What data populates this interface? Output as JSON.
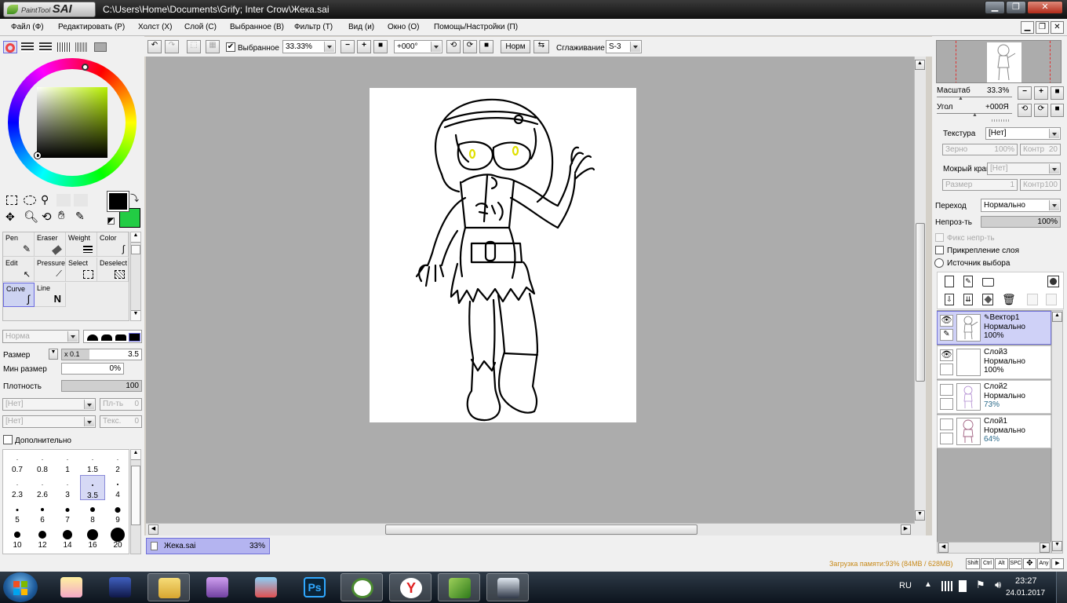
{
  "window": {
    "title": "C:\\Users\\Home\\Documents\\Grify; Inter Crow\\Жека.sai",
    "logo_top": "PaintTool",
    "logo_main": "SAI"
  },
  "menu": [
    "Файл (Ф)",
    "Редактировать (Р)",
    "Холст (Х)",
    "Слой (С)",
    "Выбранное (В)",
    "Фильтр (Т)",
    "Вид (и)",
    "Окно (О)",
    "Помощь/Настройки (П)"
  ],
  "toolbar": {
    "selection_label": "Выбранное",
    "zoom": "33.33%",
    "angle": "+000°",
    "mode_btn": "Норм",
    "smoothing_label": "Сглаживание",
    "smoothing_value": "S-3"
  },
  "tools": [
    {
      "name": "Pen",
      "icon": "pen-icon"
    },
    {
      "name": "Eraser",
      "icon": "eraser-icon"
    },
    {
      "name": "Weight",
      "icon": "weight-icon"
    },
    {
      "name": "Color",
      "icon": "color-icon"
    },
    {
      "name": "Edit",
      "icon": "edit-icon"
    },
    {
      "name": "Pressure",
      "icon": "pressure-icon"
    },
    {
      "name": "Select",
      "icon": "select-icon"
    },
    {
      "name": "Deselect",
      "icon": "deselect-icon"
    },
    {
      "name": "Curve",
      "icon": "curve-icon"
    },
    {
      "name": "Line",
      "icon": "line-icon"
    }
  ],
  "brush": {
    "mode": "Норма",
    "size_label": "Размер",
    "size_mult": "x 0.1",
    "size_value": "3.5",
    "min_size_label": "Мин размер",
    "min_size_value": "0%",
    "density_label": "Плотность",
    "density_value": "100",
    "texture1": "[Нет]",
    "texture1_label": "Пл-ть",
    "texture1_value": "0",
    "texture2": "[Нет]",
    "texture2_label": "Текс.",
    "texture2_value": "0",
    "advanced_label": "Дополнительно"
  },
  "brush_sizes": [
    {
      "label": "0.7",
      "dot": 1
    },
    {
      "label": "0.8",
      "dot": 1
    },
    {
      "label": "1",
      "dot": 1
    },
    {
      "label": "1.5",
      "dot": 1
    },
    {
      "label": "2",
      "dot": 1
    },
    {
      "label": "2.3",
      "dot": 1
    },
    {
      "label": "2.6",
      "dot": 1
    },
    {
      "label": "3",
      "dot": 1
    },
    {
      "label": "3.5",
      "dot": 2
    },
    {
      "label": "4",
      "dot": 2
    },
    {
      "label": "5",
      "dot": 3
    },
    {
      "label": "6",
      "dot": 4
    },
    {
      "label": "7",
      "dot": 5
    },
    {
      "label": "8",
      "dot": 6
    },
    {
      "label": "9",
      "dot": 7
    },
    {
      "label": "10",
      "dot": 8
    },
    {
      "label": "12",
      "dot": 10
    },
    {
      "label": "14",
      "dot": 12
    },
    {
      "label": "16",
      "dot": 14
    },
    {
      "label": "20",
      "dot": 18
    }
  ],
  "navigator": {
    "zoom_label": "Масштаб",
    "zoom_value": "33.3%",
    "angle_label": "Угол",
    "angle_value": "+000Я"
  },
  "layer_props": {
    "texture_label": "Текстура",
    "texture_value": "[Нет]",
    "grain_label": "Зерно",
    "grain_value": "100%",
    "contrast_label": "Контр",
    "contrast_value": "20",
    "wet_label": "Мокрый край",
    "wet_value": "[Нет]",
    "wsize_label": "Размер",
    "wsize_value": "1",
    "wcontrast_label": "Контр",
    "wcontrast_value": "100",
    "blend_label": "Переход",
    "blend_value": "Нормально",
    "opacity_label": "Непроз-ть",
    "opacity_value": "100%",
    "fix_label": "Фикс непр-ть",
    "clip_label": "Прикрепление слоя",
    "source_label": "Источник выбора"
  },
  "layers": [
    {
      "name": "Вектор1",
      "mode": "Нормально",
      "opacity": "100%"
    },
    {
      "name": "Слой3",
      "mode": "Нормально",
      "opacity": "100%"
    },
    {
      "name": "Слой2",
      "mode": "Нормально",
      "opacity": "73%"
    },
    {
      "name": "Слой1",
      "mode": "Нормально",
      "opacity": "64%"
    }
  ],
  "doc_tab": {
    "name": "Жека.sai",
    "zoom": "33%"
  },
  "status": {
    "memory": "Загрузка памяти:93% (84MB / 628MB)",
    "keys": [
      "Shift",
      "Ctrl",
      "Alt",
      "SPC",
      "",
      "Any"
    ]
  },
  "taskbar": {
    "lang": "RU",
    "time": "23:27",
    "date": "24.01.2017"
  },
  "colors": {
    "primary": "#000000",
    "secondary": "#22cc44",
    "accent": "#6a6ae0"
  }
}
